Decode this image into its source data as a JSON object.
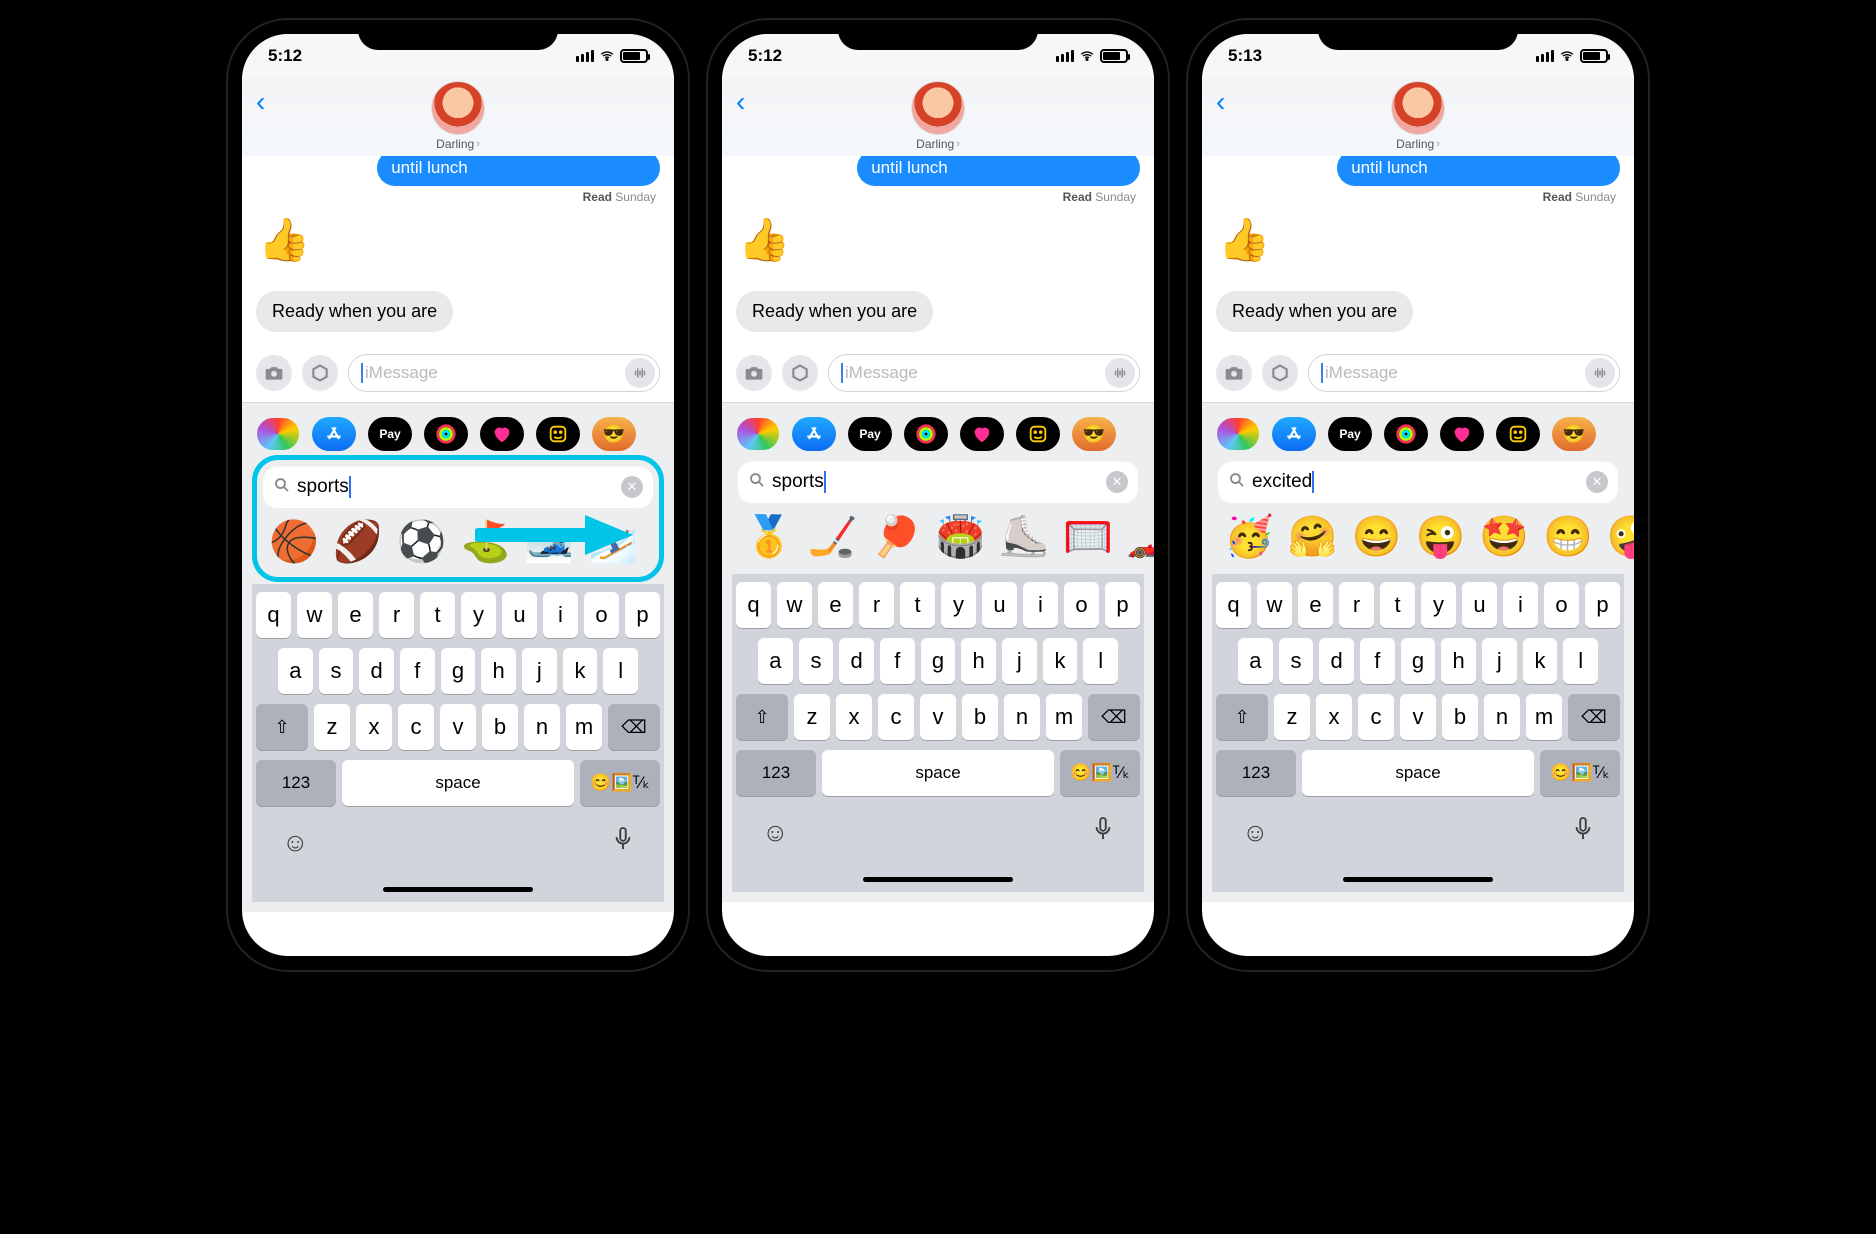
{
  "phones": [
    {
      "status_time": "5:12",
      "contact_name": "Darling",
      "sent_message": "until lunch",
      "read_label": "Read",
      "read_time": "Sunday",
      "thumbs_emoji": "👍",
      "received_message": "Ready when you are",
      "compose_placeholder": "iMessage",
      "search_value": "sports",
      "emoji_results": [
        "🏀",
        "🏈",
        "⚽",
        "⛳",
        "🎿",
        "⛷️"
      ],
      "highlight": true
    },
    {
      "status_time": "5:12",
      "contact_name": "Darling",
      "sent_message": "until lunch",
      "read_label": "Read",
      "read_time": "Sunday",
      "thumbs_emoji": "👍",
      "received_message": "Ready when you are",
      "compose_placeholder": "iMessage",
      "search_value": "sports",
      "emoji_results": [
        "🥇",
        "🏒",
        "🏓",
        "🏟️",
        "⛸️",
        "🥅",
        "🏎️"
      ],
      "highlight": false
    },
    {
      "status_time": "5:13",
      "contact_name": "Darling",
      "sent_message": "until lunch",
      "read_label": "Read",
      "read_time": "Sunday",
      "thumbs_emoji": "👍",
      "received_message": "Ready when you are",
      "compose_placeholder": "iMessage",
      "search_value": "excited",
      "emoji_results": [
        "🥳",
        "🤗",
        "😄",
        "😜",
        "🤩",
        "😁",
        "🤪"
      ],
      "highlight": false
    }
  ],
  "keyboard": {
    "row1": [
      "q",
      "w",
      "e",
      "r",
      "t",
      "y",
      "u",
      "i",
      "o",
      "p"
    ],
    "row2": [
      "a",
      "s",
      "d",
      "f",
      "g",
      "h",
      "j",
      "k",
      "l"
    ],
    "row3": [
      "z",
      "x",
      "c",
      "v",
      "b",
      "n",
      "m"
    ],
    "num_label": "123",
    "space_label": "space"
  },
  "tray_apay": "Pay"
}
